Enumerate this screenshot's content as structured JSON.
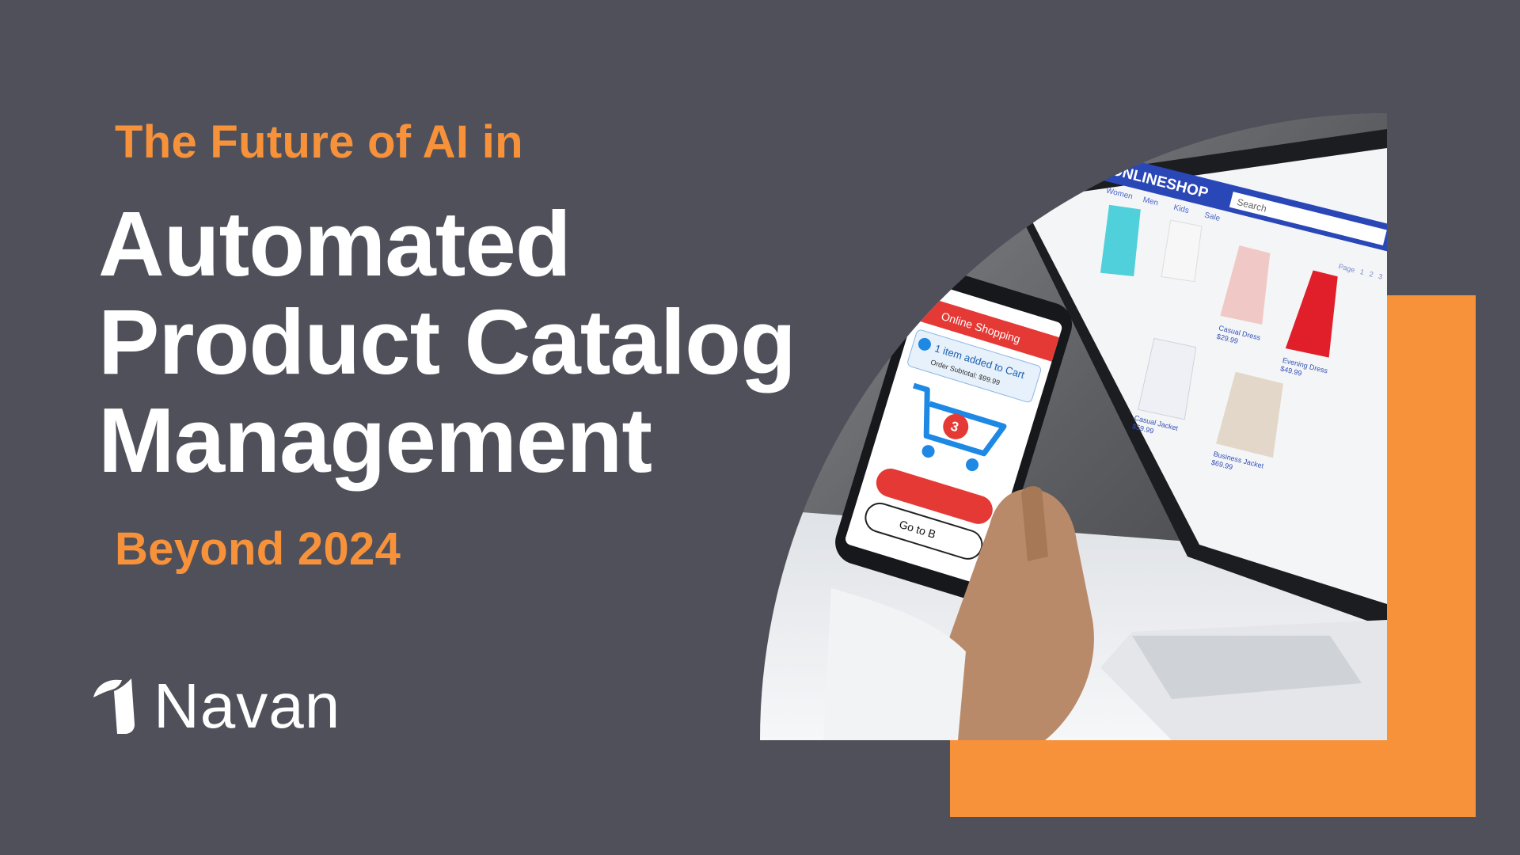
{
  "banner": {
    "kicker_top": "The Future of AI in",
    "headline": [
      "Automated",
      "Product Catalog",
      "Management"
    ],
    "kicker_bottom": "Beyond 2024"
  },
  "brand": {
    "name": "Navan"
  },
  "hero_image": {
    "shop": {
      "logo": "ONLINESHOP",
      "search_placeholder": "Search",
      "nav": [
        "Women",
        "Men",
        "Kids",
        "Sale"
      ],
      "pagination": [
        "Page",
        "1",
        "2",
        "3"
      ],
      "products": [
        {
          "name": "Casual Dress",
          "price": "$29.99"
        },
        {
          "name": "Evening Dress",
          "price": "$49.99"
        },
        {
          "name": "Casual Jacket",
          "price": "$59.99"
        },
        {
          "name": "Business Jacket",
          "price": "$69.99"
        }
      ]
    },
    "phone": {
      "header": "Online Shopping",
      "confirmation": "1 item added to Cart",
      "subtotal": "Order Subtotal: $99.99",
      "cart_count": "3",
      "go_button": "Go to B"
    }
  },
  "colors": {
    "background": "#50505a",
    "accent": "#f7923a",
    "text": "#ffffff"
  }
}
